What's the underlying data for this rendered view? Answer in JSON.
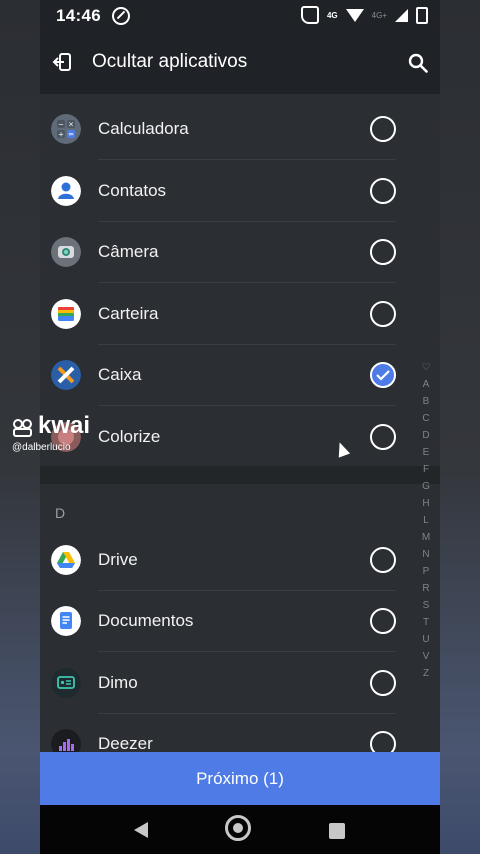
{
  "status_bar": {
    "time": "14:46",
    "net1": "4G",
    "net2": "4G+"
  },
  "app_bar": {
    "title": "Ocultar aplicativos"
  },
  "apps_top": [
    {
      "label": "Calculadora",
      "icon": "calculator-icon",
      "checked": false
    },
    {
      "label": "Contatos",
      "icon": "contacts-icon",
      "checked": false
    },
    {
      "label": "Câmera",
      "icon": "camera-icon",
      "checked": false
    },
    {
      "label": "Carteira",
      "icon": "wallet-icon",
      "checked": false
    },
    {
      "label": "Caixa",
      "icon": "caixa-icon",
      "checked": true
    },
    {
      "label": "Colorize",
      "icon": "colorize-icon",
      "checked": false
    }
  ],
  "section_d": {
    "header": "D"
  },
  "apps_d": [
    {
      "label": "Drive",
      "icon": "drive-icon",
      "checked": false
    },
    {
      "label": "Documentos",
      "icon": "docs-icon",
      "checked": false
    },
    {
      "label": "Dimo",
      "icon": "dimo-icon",
      "checked": false
    },
    {
      "label": "Deezer",
      "icon": "deezer-icon",
      "checked": false
    }
  ],
  "index_letters": [
    "♡",
    "A",
    "B",
    "C",
    "D",
    "E",
    "F",
    "G",
    "H",
    "L",
    "M",
    "N",
    "P",
    "R",
    "S",
    "T",
    "U",
    "V",
    "Z"
  ],
  "next_button": {
    "label": "Próximo (1)"
  },
  "watermark": {
    "brand": "kwai",
    "handle": "@dalberlucio"
  },
  "colors": {
    "accent": "#4e7be6",
    "background": "#2b2e33",
    "bar": "#1f2226"
  }
}
